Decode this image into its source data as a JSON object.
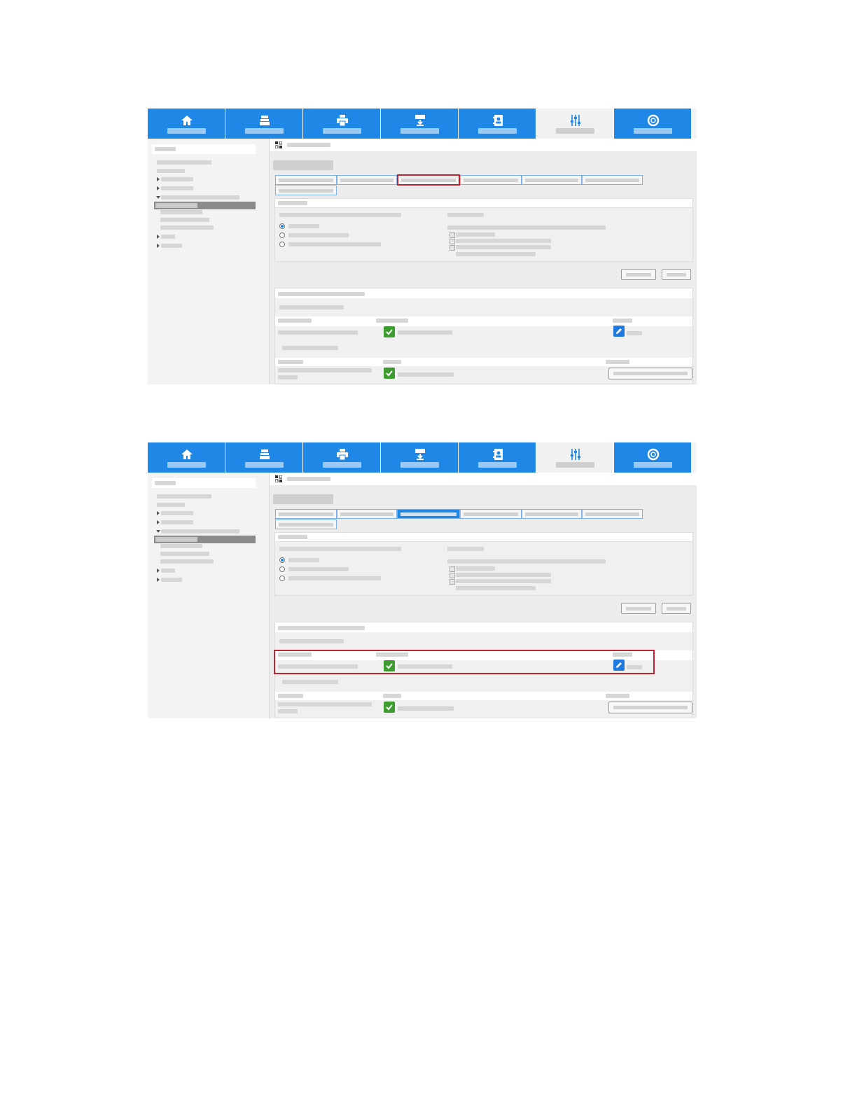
{
  "screenshots": [
    {
      "nav": [
        {
          "icon": "home-icon"
        },
        {
          "icon": "scan-tray-icon"
        },
        {
          "icon": "printer-icon"
        },
        {
          "icon": "download-icon"
        },
        {
          "icon": "address-book-icon"
        },
        {
          "icon": "settings-sliders-icon",
          "active": true
        },
        {
          "icon": "support-icon"
        }
      ],
      "highlight": "third-tab"
    },
    {
      "nav": [
        {
          "icon": "home-icon"
        },
        {
          "icon": "scan-tray-icon"
        },
        {
          "icon": "printer-icon"
        },
        {
          "icon": "download-icon"
        },
        {
          "icon": "address-book-icon"
        },
        {
          "icon": "settings-sliders-icon",
          "active": true
        },
        {
          "icon": "support-icon"
        }
      ],
      "highlight": "first-table-row"
    }
  ],
  "colors": {
    "nav_blue": "#1f88e6",
    "highlight_red": "#c0252f",
    "check_green": "#3e9b2f",
    "edit_blue": "#1f7ae0"
  }
}
